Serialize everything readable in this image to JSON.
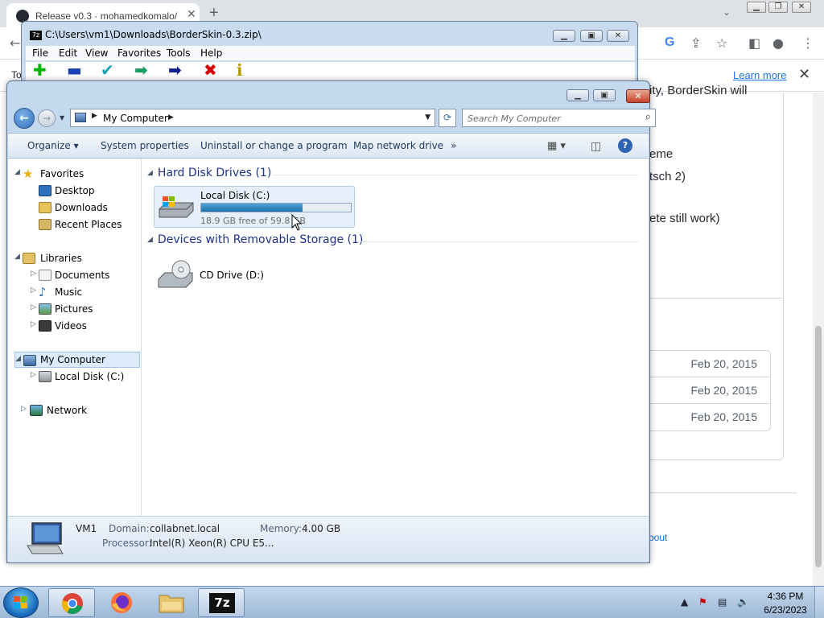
{
  "browser": {
    "tab_title": "Release v0.3 · mohamedkomalo/",
    "tab_close": "✕",
    "new_tab": "+",
    "window_controls": [
      "▁",
      "❐",
      "✕"
    ],
    "infobar_prefix": "To",
    "learn_more": "Learn more",
    "infobar_close": "✕",
    "page_fragments": [
      "ity, BorderSkin will",
      "eme",
      "tsch 2)",
      "ete still work)"
    ],
    "asset_dates": [
      "Feb 20, 2015",
      "Feb 20, 2015",
      "Feb 20, 2015"
    ],
    "footer_link": "bout"
  },
  "sevenzip": {
    "title": "C:\\Users\\vm1\\Downloads\\BorderSkin-0.3.zip\\",
    "icon_label": "7z",
    "menu": [
      "File",
      "Edit",
      "View",
      "Favorites",
      "Tools",
      "Help"
    ],
    "toolbar": [
      {
        "name": "add-icon",
        "glyph": "✚",
        "color": "#00b400"
      },
      {
        "name": "extract-icon",
        "glyph": "▬",
        "color": "#1b3fb5"
      },
      {
        "name": "test-icon",
        "glyph": "✔",
        "color": "#1aa3b5"
      },
      {
        "name": "copy-icon",
        "glyph": "➡",
        "color": "#1a9c5c"
      },
      {
        "name": "move-icon",
        "glyph": "➡",
        "color": "#0e1e8a"
      },
      {
        "name": "delete-icon",
        "glyph": "✖",
        "color": "#d40000"
      },
      {
        "name": "info-icon",
        "glyph": "ℹ",
        "color": "#b59b00"
      }
    ]
  },
  "explorer": {
    "address": {
      "crumb": "My Computer",
      "sep": "▶"
    },
    "search": {
      "placeholder": "Search My Computer"
    },
    "commands": [
      "Organize ▾",
      "System properties",
      "Uninstall or change a program",
      "Map network drive",
      "»"
    ],
    "nav": {
      "favorites": "Favorites",
      "desktop": "Desktop",
      "downloads": "Downloads",
      "recent": "Recent Places",
      "libraries": "Libraries",
      "documents": "Documents",
      "music": "Music",
      "pictures": "Pictures",
      "videos": "Videos",
      "computer": "My Computer",
      "local_disk": "Local Disk (C:)",
      "network": "Network"
    },
    "groups": {
      "hdd": "Hard Disk Drives (1)",
      "removable": "Devices with Removable Storage (1)"
    },
    "drive_c": {
      "name": "Local Disk (C:)",
      "free_text": "18.9 GB free of 59.8 GB",
      "used_fraction": 0.68
    },
    "drive_d": {
      "name": "CD Drive (D:)"
    },
    "details": {
      "computer_name": "VM1",
      "domain_label": "Domain:",
      "domain_value": "collabnet.local",
      "memory_label": "Memory:",
      "memory_value": "4.00 GB",
      "processor_label": "Processor:",
      "processor_value": "Intel(R) Xeon(R) CPU E5..."
    }
  },
  "taskbar": {
    "time": "4:36 PM",
    "date": "6/23/2023",
    "sevenzip_label": "7z"
  }
}
